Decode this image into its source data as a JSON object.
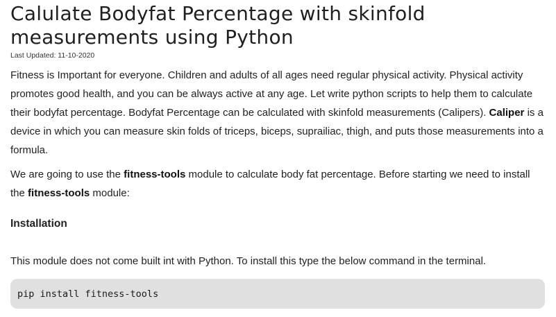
{
  "article": {
    "title": "Calulate Bodyfat Percentage with skinfold measurements using Python",
    "last_updated": "Last Updated: 11-10-2020",
    "intro": {
      "text_1": "Fitness is Important for everyone. Children and adults of all ages need regular physical activity. Physical activity promotes good health, and you can be always active at any age. Let write python scripts to help them to calculate their bodyfat percentage. Bodyfat Percentage can be calculated with skinfold measurements (Calipers). ",
      "bold_1": "Caliper",
      "text_2": " is a device in which you can measure skin folds of triceps, biceps, suprailiac, thigh, and puts those measurements into a formula."
    },
    "module_para": {
      "text_1": "We are going to use the ",
      "bold_1": "fitness-tools",
      "text_2": " module to calculate body fat percentage. Before starting we need to install the ",
      "bold_2": "fitness-tools",
      "text_3": " module:"
    },
    "installation_heading": "Installation",
    "install_para": "This module does not come built int with Python. To install this type the below command in the terminal.",
    "code": "pip install fitness-tools"
  }
}
